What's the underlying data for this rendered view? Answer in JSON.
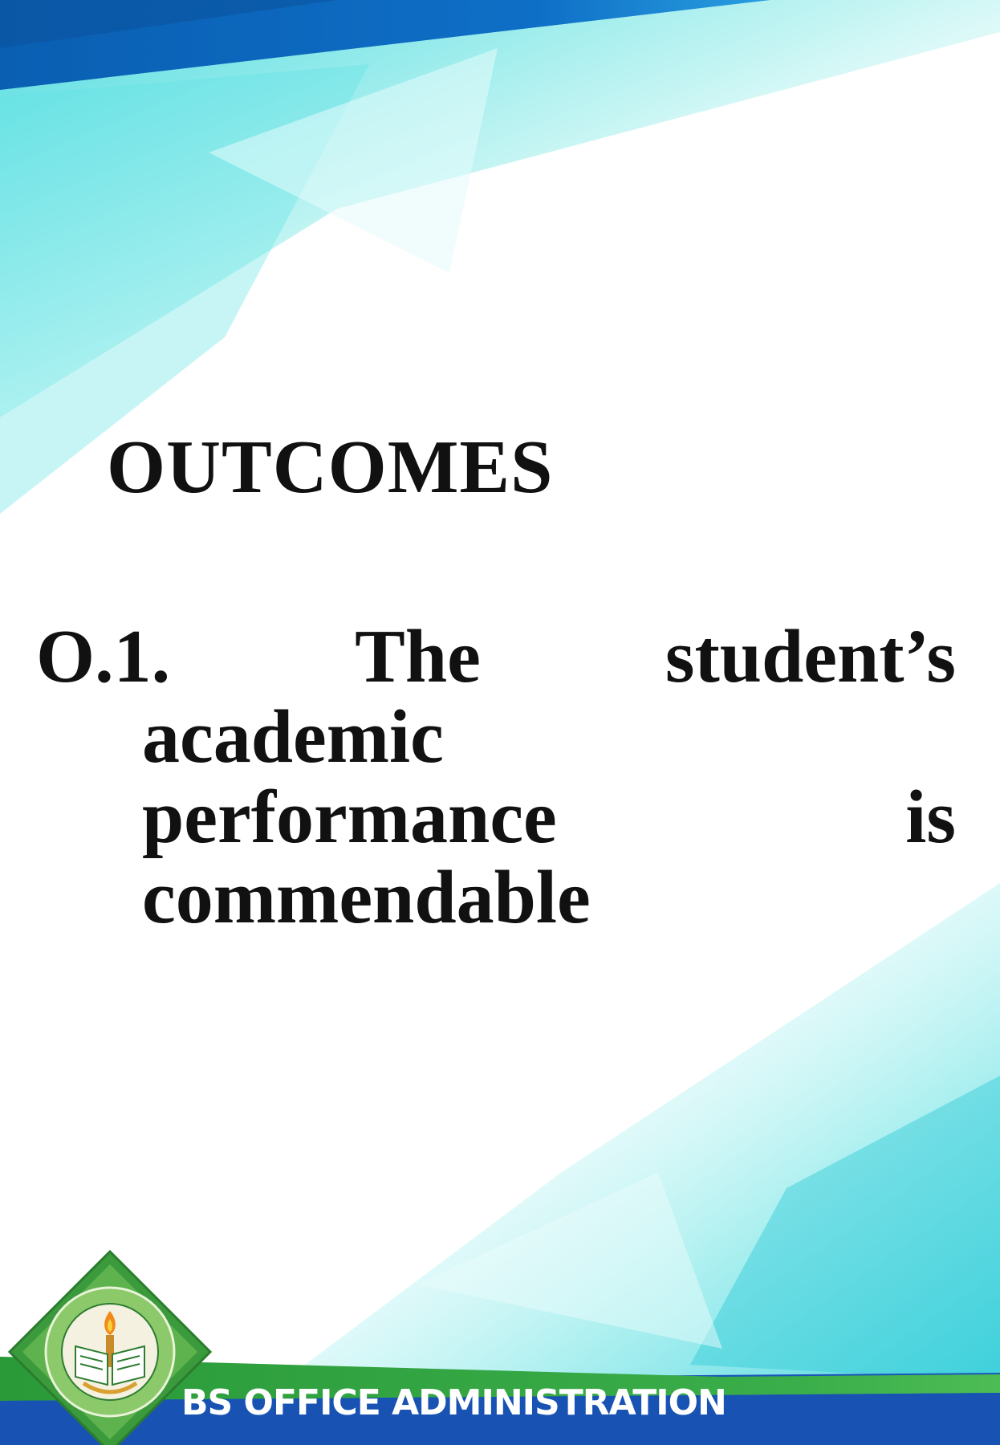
{
  "slide": {
    "title": "OUTCOMES",
    "outcome": {
      "number": "O.1.",
      "word_the": "The",
      "word_students": "student’s",
      "word_academic": "academic",
      "word_performance": "performance",
      "word_is": "is",
      "word_commendable": "commendable"
    },
    "footer": "BS OFFICE ADMINISTRATION",
    "logo": {
      "icon": "university-seal-icon"
    }
  },
  "colors": {
    "top_band": "#0a63b8",
    "teal_light": "#4fe0e0",
    "footer_green": "#2b9e3c",
    "footer_blue": "#1a56b8",
    "text": "#111111"
  }
}
